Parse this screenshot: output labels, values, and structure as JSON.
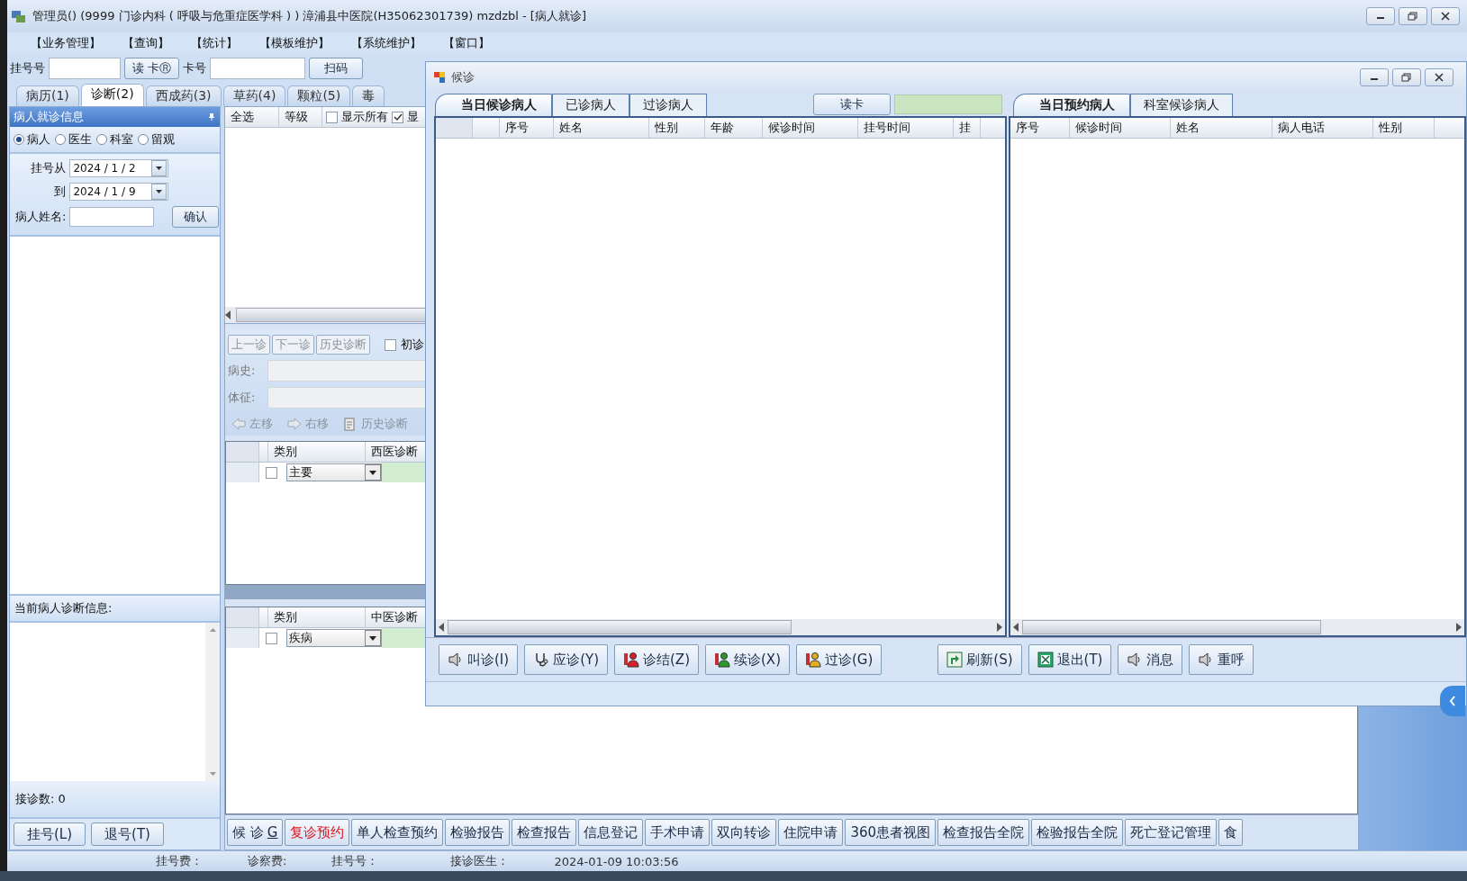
{
  "window": {
    "title": "管理员() (9999 门诊内科 ( 呼吸与危重症医学科 ) ) 漳浦县中医院(H35062301739) mzdzbl - [病人就诊]"
  },
  "menu": [
    "【业务管理】",
    "【查询】",
    "【统计】",
    "【模板维护】",
    "【系统维护】",
    "【窗口】"
  ],
  "toolbar": {
    "reg_no_label": "挂号号",
    "read_card_button": "读 卡Ⓡ",
    "card_no_label": "卡号",
    "scan_button": "扫码"
  },
  "tabs": [
    {
      "label": "病历(1)",
      "selected": false
    },
    {
      "label": "诊断(2)",
      "selected": true
    },
    {
      "label": "西成药(3)",
      "selected": false
    },
    {
      "label": "草药(4)",
      "selected": false
    },
    {
      "label": "颗粒(5)",
      "selected": false
    },
    {
      "label": "毒",
      "selected": false
    }
  ],
  "patient_panel": {
    "title": "病人就诊信息",
    "filters": [
      {
        "label": "病人",
        "selected": true
      },
      {
        "label": "医生",
        "selected": false
      },
      {
        "label": "科室",
        "selected": false
      },
      {
        "label": "留观",
        "selected": false
      }
    ],
    "date_from_label": "挂号从",
    "date_from": "2024 / 1 / 2",
    "date_to_label": "到",
    "date_to": "2024 / 1 / 9",
    "name_label": "病人姓名:",
    "confirm_button": "确认",
    "diagnosis_label": "当前病人诊断信息:",
    "count_label": "接诊数: 0",
    "buttons": [
      "挂号(L)",
      "退号(T)"
    ]
  },
  "center": {
    "grid_columns": [
      "全选",
      "等级"
    ],
    "options": [
      {
        "label": "显示所有",
        "checked": false
      },
      {
        "label": "显",
        "checked": true
      }
    ],
    "nav_buttons": [
      "上一诊",
      "下一诊",
      "历史诊断"
    ],
    "first_visit": {
      "label": "初诊",
      "checked": false
    },
    "history_label": "病史:",
    "signs_label": "体征:",
    "move_tools": [
      {
        "label": "左移",
        "kind": "left"
      },
      {
        "label": "右移",
        "kind": "right"
      },
      {
        "label": "历史诊断",
        "kind": "history"
      }
    ],
    "western_grid": {
      "columns": [
        "类别",
        "西医诊断"
      ],
      "rows": [
        {
          "checked": false,
          "type": "主要"
        }
      ]
    },
    "tcm_grid": {
      "columns": [
        "类别",
        "中医诊断"
      ],
      "rows": [
        {
          "checked": false,
          "type": "疾病"
        }
      ]
    },
    "bottom_buttons": [
      {
        "label": "候 诊",
        "shortcut": "G",
        "kind": "normal"
      },
      {
        "label": "复诊预约",
        "kind": "alert"
      },
      {
        "label": "单人检查预约",
        "kind": "normal"
      },
      {
        "label": "检验报告",
        "kind": "normal"
      },
      {
        "label": "检查报告",
        "kind": "normal"
      },
      {
        "label": "信息登记",
        "kind": "normal"
      },
      {
        "label": "手术申请",
        "kind": "normal"
      },
      {
        "label": "双向转诊",
        "kind": "normal"
      },
      {
        "label": "住院申请",
        "kind": "normal"
      },
      {
        "label": "360患者视图",
        "kind": "normal"
      },
      {
        "label": "检查报告全院",
        "kind": "normal"
      },
      {
        "label": "检验报告全院",
        "kind": "normal"
      },
      {
        "label": "死亡登记管理",
        "kind": "normal"
      },
      {
        "label": "食",
        "kind": "normal"
      }
    ]
  },
  "status_bar": [
    "挂号费：",
    "诊察费:",
    "挂号号：",
    "接诊医生：",
    "2024-01-09 10:03:56"
  ],
  "dialog": {
    "title": "候诊",
    "left_tabs": [
      {
        "label": "当日候诊病人",
        "selected": true
      },
      {
        "label": "已诊病人",
        "selected": false
      },
      {
        "label": "过诊病人",
        "selected": false
      }
    ],
    "read_card_button": "读卡",
    "right_tabs": [
      {
        "label": "当日预约病人",
        "selected": true
      },
      {
        "label": "科室候诊病人",
        "selected": false
      }
    ],
    "left_columns": [
      "序号",
      "姓名",
      "性别",
      "年龄",
      "候诊时间",
      "挂号时间",
      "挂"
    ],
    "right_columns": [
      "序号",
      "候诊时间",
      "姓名",
      "病人电话",
      "性别"
    ],
    "buttons": [
      {
        "label": "叫诊(I)",
        "kind": "speaker"
      },
      {
        "label": "应诊(Y)",
        "kind": "stethoscope"
      },
      {
        "label": "诊结(Z)",
        "kind": "person-red"
      },
      {
        "label": "续诊(X)",
        "kind": "person-green"
      },
      {
        "label": "过诊(G)",
        "kind": "person-yellow"
      },
      {
        "label": "刷新(S)",
        "kind": "refresh"
      },
      {
        "label": "退出(T)",
        "kind": "exit"
      },
      {
        "label": "消息",
        "kind": "speaker"
      },
      {
        "label": "重呼",
        "kind": "speaker"
      }
    ]
  }
}
